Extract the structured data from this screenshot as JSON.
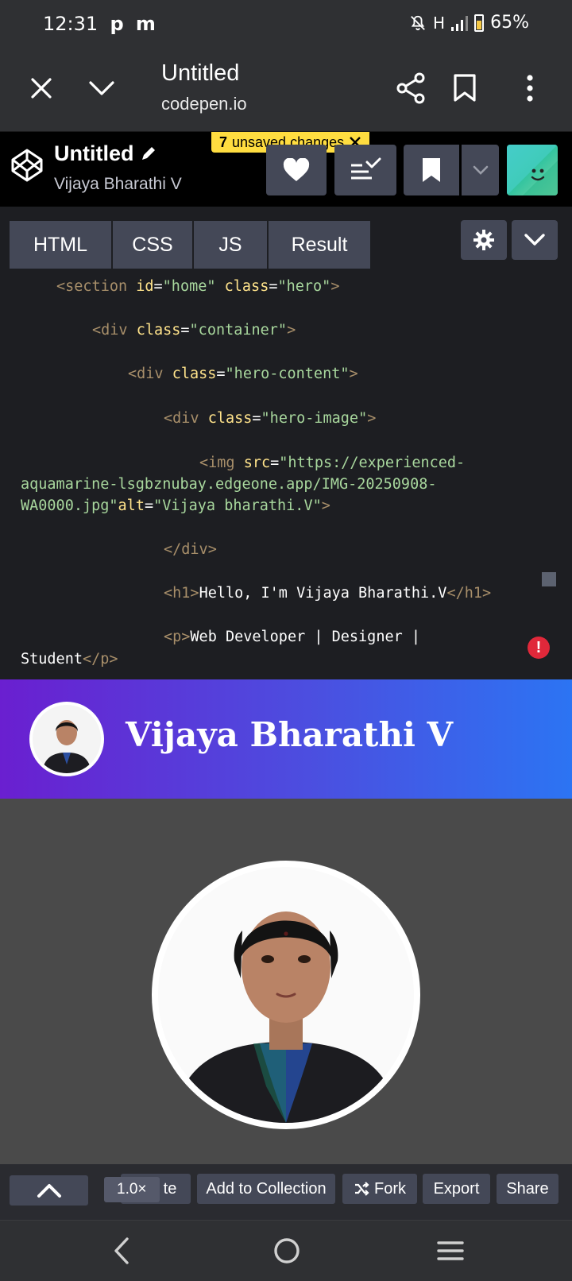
{
  "status_bar": {
    "time": "12:31",
    "notification_icons": [
      "p",
      "m"
    ],
    "network": "H",
    "battery": "65%",
    "battery_level": 0.65
  },
  "browser": {
    "title": "Untitled",
    "domain": "codepen.io"
  },
  "codepen": {
    "pen_title": "Untitled",
    "author": "Vijaya Bharathi V",
    "unsaved_count": "7",
    "unsaved_label": "unsaved changes"
  },
  "editor": {
    "tabs": [
      {
        "label": "HTML"
      },
      {
        "label": "CSS"
      },
      {
        "label": "JS"
      },
      {
        "label": "Result"
      }
    ],
    "code_lines": [
      {
        "p1": "<section ",
        "a1": "id",
        "e1": "=",
        "v1": "\"home\"",
        "s1": " ",
        "a2": "class",
        "e2": "=",
        "v2": "\"hero\"",
        "p2": ">"
      },
      {
        "p1": "<div ",
        "a1": "class",
        "e1": "=",
        "v1": "\"container\"",
        "p2": ">"
      },
      {
        "p1": "<div ",
        "a1": "class",
        "e1": "=",
        "v1": "\"hero-content\"",
        "p2": ">"
      },
      {
        "p1": "<div ",
        "a1": "class",
        "e1": "=",
        "v1": "\"hero-image\"",
        "p2": ">"
      },
      {
        "p1": "<img ",
        "a1": "src",
        "e1": "=",
        "v1": "\"https://experienced-"
      },
      {
        "v1": "aquamarine-lsgbznubay.edgeone.app/IMG-20250908-"
      },
      {
        "v1": "WA0000.jpg\"",
        "a1": "alt",
        "e1": "=",
        "v2": "\"Vijaya bharathi.V\"",
        "p2": ">"
      },
      {
        "p1": "</div>"
      },
      {
        "p1": "<h1>",
        "t1": "Hello, I'm Vijaya Bharathi.V",
        "p2": "</h1>"
      },
      {
        "p1": "<p>",
        "t1": "Web Developer | Designer |"
      },
      {
        "t1": "Student",
        "p2": "</p>"
      }
    ]
  },
  "preview": {
    "hero_name": "Vijaya Bharathi V"
  },
  "bottom_toolbar": {
    "partial_label": "te",
    "zoom": "1.0×",
    "add_to_collection": "Add to Collection",
    "fork": "Fork",
    "export": "Export",
    "share": "Share"
  },
  "colors": {
    "accent_yellow": "#ffdd40",
    "hero_gradient_start": "#6a1fd0",
    "hero_gradient_end": "#2c74f3",
    "error_red": "#e0283a"
  },
  "icons": [
    "close-icon",
    "chevron-down-icon",
    "share-icon",
    "bookmark-icon",
    "more-vert-icon",
    "codepen-logo-icon",
    "pencil-icon",
    "heart-icon",
    "sort-icon",
    "bookmark-icon",
    "chevron-down-icon",
    "gear-icon",
    "chevron-up-icon",
    "fork-icon",
    "back-icon",
    "home-icon",
    "recents-icon"
  ]
}
